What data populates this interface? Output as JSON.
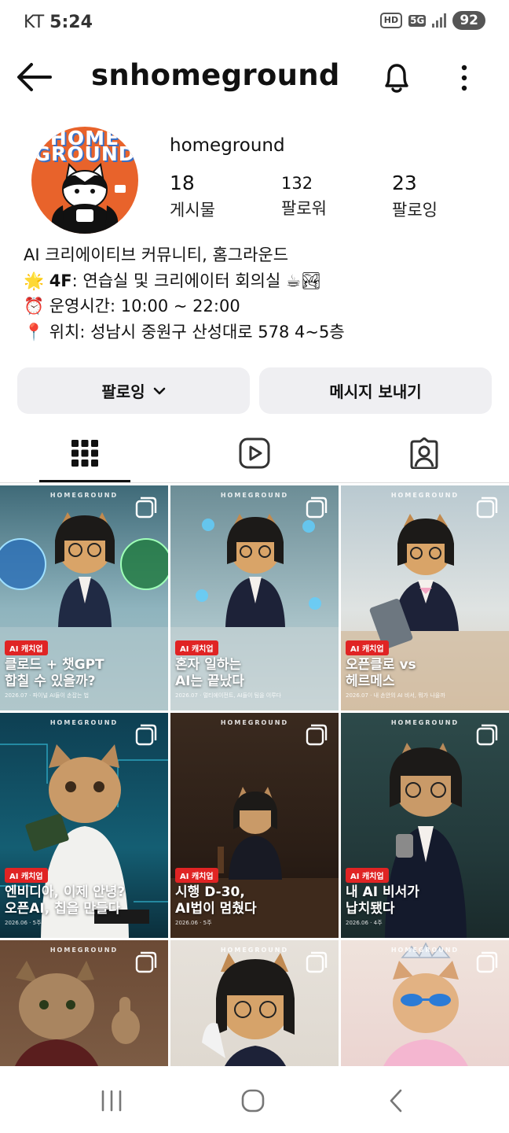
{
  "status_bar": {
    "carrier": "KT",
    "time": "5:24",
    "hd": "HD",
    "network": "5G",
    "battery": "92"
  },
  "header": {
    "username": "snhomeground"
  },
  "profile": {
    "avatar_text": [
      "HOME",
      "GROUND"
    ],
    "display_name": "homeground",
    "stats": [
      {
        "value": "18",
        "label": "게시물"
      },
      {
        "value": "132",
        "label": "팔로워"
      },
      {
        "value": "23",
        "label": "팔로잉"
      }
    ],
    "bio": [
      {
        "emoji": "",
        "text": "AI 크리에이티브 커뮤니티, 홈그라운드"
      },
      {
        "emoji": "🌟",
        "bold": "4F",
        "text": ": 연습실 및 크리에이터 회의실 ☕🏞"
      },
      {
        "emoji": "⏰",
        "text": "운영시간: 10:00 ~ 22:00"
      },
      {
        "emoji": "📍",
        "text": "위치: 성남시 중원구 산성대로 578 4~5층"
      }
    ]
  },
  "actions": {
    "following_label": "팔로잉",
    "message_label": "메시지 보내기"
  },
  "grid": {
    "brand": "HOMEGROUND",
    "tiles": [
      {
        "tag": "AI 캐치업",
        "title": [
          "클로드 + 챗GPT",
          "합칠 수 있을까?"
        ],
        "sub": "2026.07 · 파이널 AI들이 손잡는 법"
      },
      {
        "tag": "AI 캐치업",
        "title": [
          "혼자 일하는",
          "AI는 끝났다"
        ],
        "sub": "2026.07 · 멀티에이전트, AI들이 팀을 이루다"
      },
      {
        "tag": "AI 캐치업",
        "title": [
          "오픈클로 vs",
          "헤르메스"
        ],
        "sub": "2026.07 · 내 손안의 AI 비서, 뭐가 나을까"
      },
      {
        "tag": "AI 캐치업",
        "title": [
          "엔비디아, 이제 안녕?",
          "오픈AI, 칩을 만들다"
        ],
        "sub": "2026.06 · 5주"
      },
      {
        "tag": "AI 캐치업",
        "title": [
          "시행 D-30,",
          "AI법이 멈췄다"
        ],
        "sub": "2026.06 · 5주"
      },
      {
        "tag": "AI 캐치업",
        "title": [
          "내 AI 비서가",
          "납치됐다"
        ],
        "sub": "2026.06 · 4주"
      },
      {
        "tag": "",
        "title": [],
        "sub": ""
      },
      {
        "tag": "",
        "title": [],
        "sub": ""
      },
      {
        "tag": "",
        "title": [],
        "sub": ""
      }
    ]
  },
  "colors": {
    "accent_red": "#e02424",
    "button_bg": "#efeff2",
    "avatar_bg": "#e8632b"
  }
}
